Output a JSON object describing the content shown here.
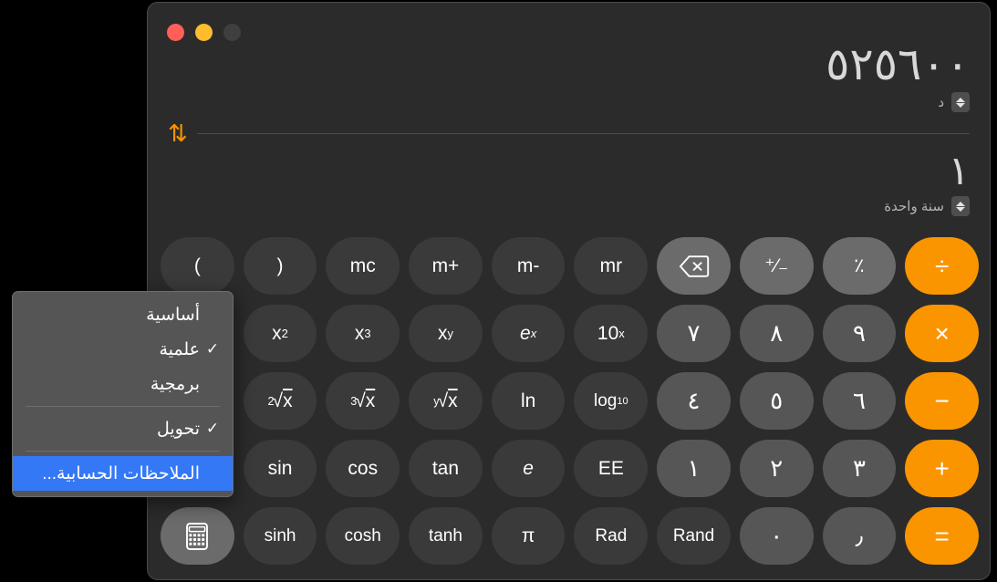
{
  "window": {
    "traffic_lights": [
      {
        "name": "close",
        "color": "#ff5f57"
      },
      {
        "name": "minimize",
        "color": "#febc2e"
      },
      {
        "name": "zoom",
        "color": "#3f3f3f"
      }
    ]
  },
  "display": {
    "top_value": "٥٢٥٦٠٠",
    "top_unit": "د",
    "swap_icon": "⇅",
    "bottom_value": "١",
    "bottom_unit": "سنة واحدة"
  },
  "menu": {
    "items": [
      {
        "label": "أساسية",
        "checked": false,
        "highlighted": false,
        "name": "menu-item-basic"
      },
      {
        "label": "علمية",
        "checked": true,
        "highlighted": false,
        "name": "menu-item-scientific"
      },
      {
        "label": "برمجية",
        "checked": false,
        "highlighted": false,
        "name": "menu-item-programmer"
      },
      {
        "separator": true
      },
      {
        "label": "تحويل",
        "checked": true,
        "highlighted": false,
        "name": "menu-item-convert"
      },
      {
        "separator": true
      },
      {
        "label": "الملاحظات الحسابية...",
        "checked": false,
        "highlighted": true,
        "name": "menu-item-math-notes"
      }
    ],
    "check_glyph": "✓"
  },
  "keypad": {
    "rows": [
      [
        {
          "label": "(",
          "style": "fn",
          "name": "paren-open-key"
        },
        {
          "label": ")",
          "style": "fn",
          "name": "paren-close-key"
        },
        {
          "label": "mc",
          "style": "fn",
          "name": "memory-clear-key"
        },
        {
          "label": "m+",
          "style": "fn",
          "name": "memory-add-key"
        },
        {
          "label": "m-",
          "style": "fn",
          "name": "memory-subtract-key"
        },
        {
          "label": "mr",
          "style": "fn",
          "name": "memory-recall-key"
        },
        {
          "label": "",
          "style": "util",
          "icon": "delete-backward-icon",
          "name": "delete-key"
        },
        {
          "label": "⁺⁄₋",
          "style": "util",
          "name": "sign-toggle-key"
        },
        {
          "label": "٪",
          "style": "util",
          "name": "percent-key"
        },
        {
          "label": "÷",
          "style": "op",
          "name": "divide-key"
        }
      ],
      [
        {
          "label": "x²",
          "style": "fn",
          "html": "x<sup>2</sup>",
          "name": "x-squared-key"
        },
        {
          "label": "x³",
          "style": "fn",
          "html": "x<sup>3</sup>",
          "name": "x-cubed-key"
        },
        {
          "label": "xʸ",
          "style": "fn",
          "html": "x<sup>y</sup>",
          "name": "x-power-y-key"
        },
        {
          "label": "eˣ",
          "style": "fn ital",
          "html": "<i>e</i><sup>x</sup>",
          "name": "e-power-x-key"
        },
        {
          "label": "10ˣ",
          "style": "fn",
          "html": "10<sup>x</sup>",
          "name": "ten-power-x-key"
        },
        {
          "label": "٧",
          "style": "num digit",
          "name": "digit-7-key"
        },
        {
          "label": "٨",
          "style": "num digit",
          "name": "digit-8-key"
        },
        {
          "label": "٩",
          "style": "num digit",
          "name": "digit-9-key"
        },
        {
          "label": "×",
          "style": "op",
          "name": "multiply-key"
        }
      ],
      [
        {
          "label": "²√x",
          "style": "fn",
          "html": "<span class='pre'>2</span>√<span style='text-decoration:overline'>x</span>",
          "name": "square-root-key"
        },
        {
          "label": "³√x",
          "style": "fn",
          "html": "<span class='pre'>3</span>√<span style='text-decoration:overline'>x</span>",
          "name": "cube-root-key"
        },
        {
          "label": "ʸ√x",
          "style": "fn",
          "html": "<span class='pre'>y</span>√<span style='text-decoration:overline'>x</span>",
          "name": "y-root-key"
        },
        {
          "label": "ln",
          "style": "fn",
          "name": "natural-log-key"
        },
        {
          "label": "log₁₀",
          "style": "fn small",
          "html": "log<sub>10</sub>",
          "name": "log-base-10-key"
        },
        {
          "label": "٤",
          "style": "num digit",
          "name": "digit-4-key"
        },
        {
          "label": "٥",
          "style": "num digit",
          "name": "digit-5-key"
        },
        {
          "label": "٦",
          "style": "num digit",
          "name": "digit-6-key"
        },
        {
          "label": "−",
          "style": "op",
          "name": "subtract-key"
        }
      ],
      [
        {
          "label": "sin",
          "style": "fn",
          "name": "sine-key"
        },
        {
          "label": "cos",
          "style": "fn",
          "name": "cosine-key"
        },
        {
          "label": "tan",
          "style": "fn",
          "name": "tangent-key"
        },
        {
          "label": "e",
          "style": "fn ital",
          "name": "euler-number-key"
        },
        {
          "label": "EE",
          "style": "fn",
          "name": "exponent-entry-key"
        },
        {
          "label": "١",
          "style": "num digit",
          "name": "digit-1-key"
        },
        {
          "label": "٢",
          "style": "num digit",
          "name": "digit-2-key"
        },
        {
          "label": "٣",
          "style": "num digit",
          "name": "digit-3-key"
        },
        {
          "label": "+",
          "style": "op",
          "name": "add-key"
        }
      ],
      [
        {
          "label": "",
          "style": "util",
          "icon": "calculator-keypad-icon",
          "name": "keypad-toggle-key"
        },
        {
          "label": "sinh",
          "style": "fn small",
          "name": "hyperbolic-sine-key"
        },
        {
          "label": "cosh",
          "style": "fn small",
          "name": "hyperbolic-cosine-key"
        },
        {
          "label": "tanh",
          "style": "fn small",
          "name": "hyperbolic-tangent-key"
        },
        {
          "label": "π",
          "style": "fn",
          "name": "pi-key"
        },
        {
          "label": "Rad",
          "style": "fn small",
          "name": "radians-key"
        },
        {
          "label": "Rand",
          "style": "fn small",
          "name": "random-key"
        },
        {
          "label": "٠",
          "style": "num digit",
          "name": "digit-0-key"
        },
        {
          "label": "٫",
          "style": "num digit",
          "name": "decimal-separator-key"
        },
        {
          "label": "=",
          "style": "op",
          "name": "equals-key"
        }
      ]
    ]
  },
  "colors": {
    "accent_orange": "#fa9500",
    "highlight_blue": "#3478f6",
    "window_bg": "#2b2b2b"
  }
}
